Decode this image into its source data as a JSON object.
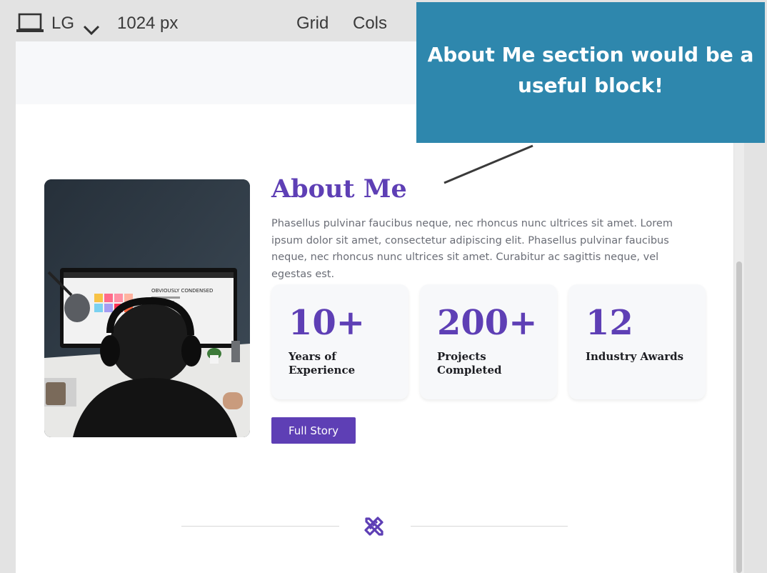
{
  "toolbar": {
    "device_icon": "laptop-icon",
    "device_label": "LG",
    "dropdown_icon": "chevron-down-icon",
    "width_label": "1024 px",
    "grid_label": "Grid",
    "cols_label": "Cols"
  },
  "tooltip": {
    "text": "About Me section would be a useful block!",
    "color": "#2e87ad"
  },
  "about": {
    "title": "About Me",
    "text": "Phasellus pulvinar faucibus neque, nec rhoncus nunc ultrices sit amet. Lorem ipsum dolor sit amet, consectetur adipiscing elit. Phasellus pulvinar faucibus neque, nec rhoncus nunc ultrices sit amet. Curabitur ac sagittis neque, vel egestas est.",
    "photo_icon": "photo-person-at-computer",
    "photo_screen_text": "OBVIOUSLY CONDENSED",
    "accent_color": "#5e3fb5",
    "stats": [
      {
        "value": "10+",
        "label": "Years of Experience"
      },
      {
        "value": "200+",
        "label": "Projects Completed"
      },
      {
        "value": "12",
        "label": "Industry Awards"
      }
    ],
    "button_label": "Full Story"
  },
  "divider": {
    "icon": "pencil-ruler-icon"
  }
}
